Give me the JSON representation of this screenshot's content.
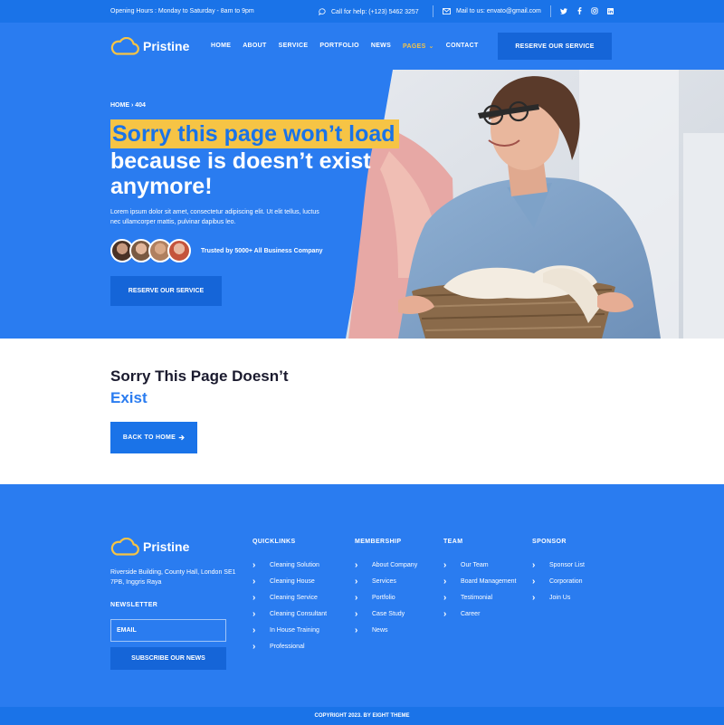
{
  "topbar": {
    "hours": "Opening Hours : Monday to Saturday - 8am to 9pm",
    "help": "Call for help: (+123) 5462 3257",
    "mail": "Mail to us: envato@gmail.com"
  },
  "brand": {
    "name": "Pristine"
  },
  "nav": {
    "items": [
      "HOME",
      "ABOUT",
      "SERVICE",
      "PORTFOLIO",
      "NEWS",
      "PAGES",
      "CONTACT"
    ],
    "cta": "RESERVE OUR SERVICE"
  },
  "hero": {
    "breadcrumb": "HOME › 404",
    "title_highlight": "Sorry this page won’t load",
    "title_rest": "because is doesn’t exist anymore!",
    "description": "Lorem ipsum dolor sit amet, consectetur adipiscing elit. Ut elit tellus, luctus nec ullamcorper mattis, pulvinar dapibus leo.",
    "trusted": "Trusted by 5000+ All Business Company",
    "cta": "RESERVE OUR SERVICE"
  },
  "notfound": {
    "title": "Sorry This Page Doesn’t",
    "subtitle": "Exist",
    "button": "BACK TO HOME"
  },
  "footer": {
    "address": "Riverside Building, County Hall, London SE1 7PB, Inggris Raya",
    "newsletter_title": "NEWSLETTER",
    "email_placeholder": "EMAIL",
    "subscribe": "SUBSCRIBE OUR NEWS",
    "columns": [
      {
        "title": "QUICKLINKS",
        "links": [
          "Cleaning Solution",
          "Cleaning House",
          "Cleaning Service",
          "Cleaning Consultant",
          "In House Training",
          "Professional"
        ]
      },
      {
        "title": "MEMBERSHIP",
        "links": [
          "About Company",
          "Services",
          "Portfolio",
          "Case Study",
          "News"
        ]
      },
      {
        "title": "TEAM",
        "links": [
          "Our Team",
          "Board Management",
          "Testimonial",
          "Career"
        ]
      },
      {
        "title": "SPONSOR",
        "links": [
          "Sponsor List",
          "Corporation",
          "Join Us"
        ]
      }
    ],
    "copyright": "COPYRIGHT 2023. BY EIGHT THEME"
  },
  "colors": {
    "primary": "#2a7cf0",
    "dark_blue": "#1565d8",
    "accent": "#f6c445",
    "text_dark": "#1a1a2e"
  },
  "icons": [
    "chat-icon",
    "mail-icon",
    "twitter-icon",
    "facebook-icon",
    "instagram-icon",
    "linkedin-icon",
    "cloud-logo-icon",
    "arrow-right-icon",
    "chevron-right-icon"
  ]
}
